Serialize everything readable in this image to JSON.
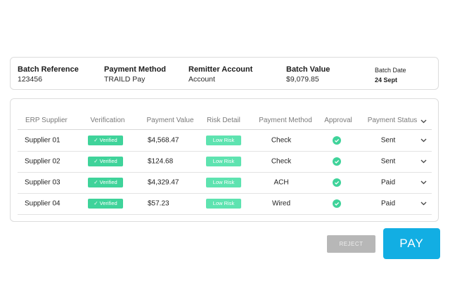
{
  "batch": {
    "reference_label": "Batch Reference",
    "reference_value": "123456",
    "method_label": "Payment Method",
    "method_value": "TRAILD Pay",
    "remitter_label": "Remitter Account",
    "remitter_value": "Account",
    "value_label": "Batch Value",
    "value_value": "$9,079.85",
    "date_label": "Batch Date",
    "date_value": "24 Sept"
  },
  "table": {
    "headers": {
      "supplier": "ERP Supplier",
      "verification": "Verification",
      "payment_value": "Payment Value",
      "risk": "Risk Detail",
      "method": "Payment Method",
      "approval": "Approval",
      "status": "Payment Status"
    },
    "rows": [
      {
        "supplier": "Supplier 01",
        "verification": "Verified",
        "payment_value": "$4,568.47",
        "risk": "Low Risk",
        "method": "Check",
        "status": "Sent"
      },
      {
        "supplier": "Supplier 02",
        "verification": "Verified",
        "payment_value": "$124.68",
        "risk": "Low Risk",
        "method": "Check",
        "status": "Sent"
      },
      {
        "supplier": "Supplier 03",
        "verification": "Verified",
        "payment_value": "$4,329.47",
        "risk": "Low Risk",
        "method": "ACH",
        "status": "Paid"
      },
      {
        "supplier": "Supplier 04",
        "verification": "Verified",
        "payment_value": "$57.23",
        "risk": "Low Risk",
        "method": "Wired",
        "status": "Paid"
      }
    ]
  },
  "actions": {
    "reject_label": "REJECT",
    "pay_label": "PAY"
  },
  "colors": {
    "verified_badge": "#3fd39a",
    "risk_badge": "#5ee3b0",
    "pay_button": "#12aee3",
    "reject_button": "#b7b7b7"
  },
  "icons": {
    "verified": "check-mark-icon",
    "approval": "check-circle-icon",
    "expand": "chevron-down-icon"
  }
}
